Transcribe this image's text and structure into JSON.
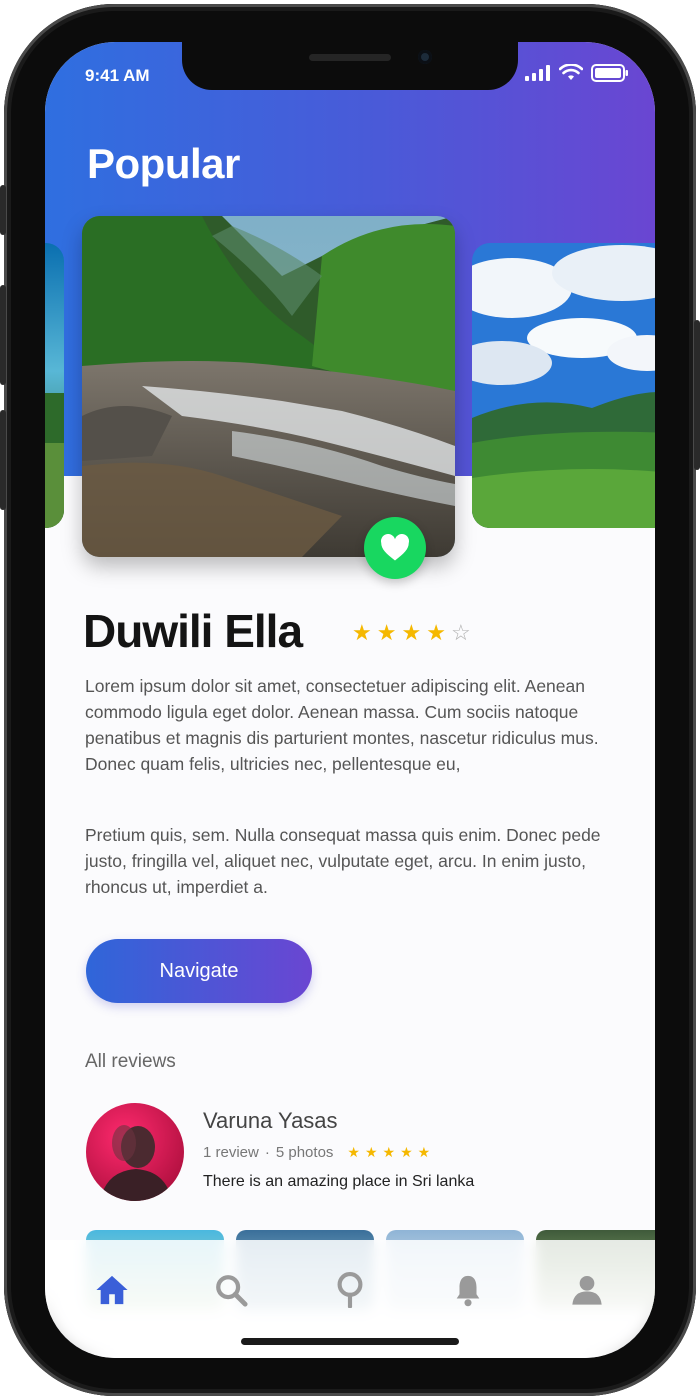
{
  "status_bar": {
    "time": "9:41 AM"
  },
  "header": {
    "title": "Popular"
  },
  "place": {
    "name": "Duwili Ella",
    "rating": 4,
    "max_rating": 5,
    "description_1": "Lorem ipsum dolor sit amet, consectetuer adipiscing elit. Aenean commodo ligula eget dolor. Aenean massa. Cum sociis natoque penatibus et magnis dis parturient montes, nascetur ridiculus mus. Donec quam felis, ultricies nec, pellentesque eu,",
    "description_2": "Pretium quis, sem. Nulla consequat massa quis enim. Donec pede justo, fringilla vel, aliquet nec, vulputate eget, arcu. In enim justo, rhoncus ut, imperdiet a.",
    "favorite": true
  },
  "actions": {
    "navigate_label": "Navigate"
  },
  "reviews": {
    "title": "All reviews",
    "items": [
      {
        "name": "Varuna Yasas",
        "count": "1 review",
        "photos": "5 photos",
        "rating": 5,
        "text": "There is an amazing place in Sri lanka"
      }
    ]
  },
  "tabbar": {
    "items": [
      {
        "icon": "home-icon",
        "active": true
      },
      {
        "icon": "search-icon",
        "active": false
      },
      {
        "icon": "location-pin-icon",
        "active": false
      },
      {
        "icon": "bell-icon",
        "active": false
      },
      {
        "icon": "user-icon",
        "active": false
      }
    ]
  },
  "colors": {
    "accent_start": "#2f6fe0",
    "accent_end": "#6a46d2",
    "favorite": "#18d760",
    "star": "#f5b800",
    "tab_active": "#3a5fd8",
    "tab_inactive": "#9a9a9a"
  }
}
